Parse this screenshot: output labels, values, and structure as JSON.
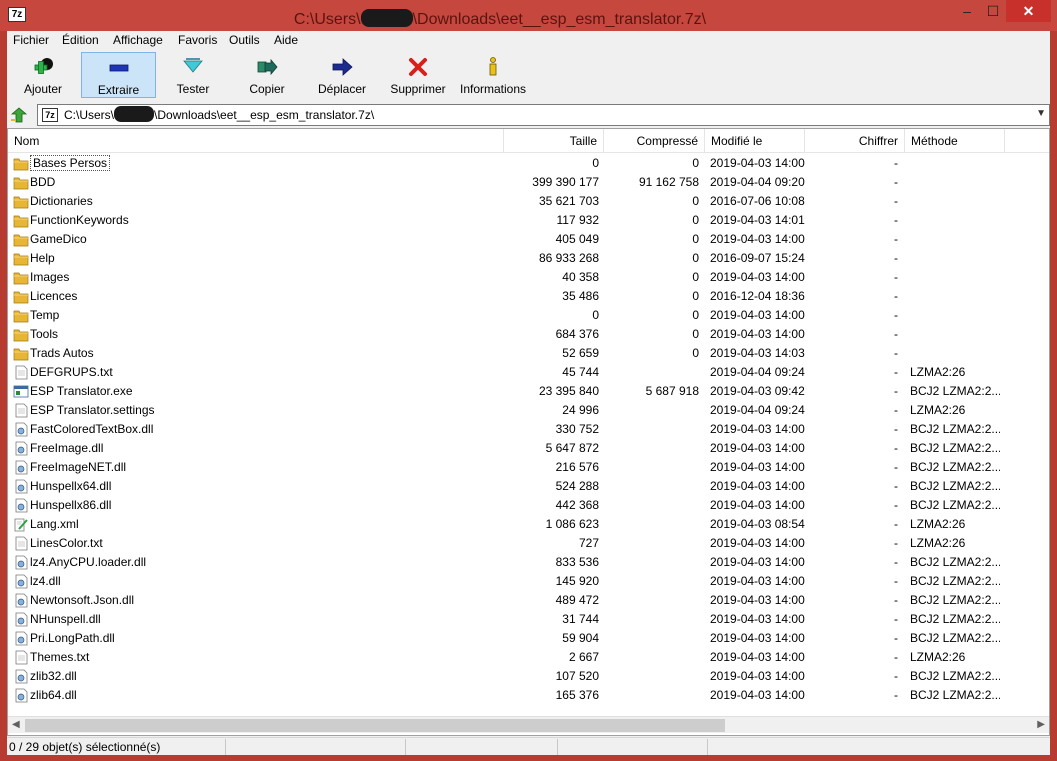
{
  "window": {
    "title_prefix": "C:\\Users\\",
    "title_suffix": "\\Downloads\\eet__esp_esm_translator.7z\\",
    "logo": "7z",
    "minimize": "–",
    "maximize": "☐",
    "close": "✕"
  },
  "menu": [
    "Fichier",
    "Édition",
    "Affichage",
    "Favoris",
    "Outils",
    "Aide"
  ],
  "toolbar": [
    {
      "label": "Ajouter",
      "icon": "add-plus-icon"
    },
    {
      "label": "Extraire",
      "icon": "extract-minus-icon",
      "active": true
    },
    {
      "label": "Tester",
      "icon": "test-check-icon"
    },
    {
      "label": "Copier",
      "icon": "copy-arrow-icon"
    },
    {
      "label": "Déplacer",
      "icon": "move-arrow-icon"
    },
    {
      "label": "Supprimer",
      "icon": "delete-x-icon"
    },
    {
      "label": "Informations",
      "icon": "info-icon"
    }
  ],
  "address": {
    "logo": "7z",
    "prefix": "C:\\Users\\",
    "suffix": "\\Downloads\\eet__esp_esm_translator.7z\\"
  },
  "columns": {
    "name": "Nom",
    "size": "Taille",
    "compressed": "Compressé",
    "modified": "Modifié le",
    "encrypted": "Chiffrer",
    "method": "Méthode"
  },
  "files": [
    {
      "name": "Bases Persos",
      "type": "folder",
      "size": "0",
      "compressed": "0",
      "modified": "2019-04-03 14:00",
      "encrypted": "-",
      "method": ""
    },
    {
      "name": "BDD",
      "type": "folder",
      "size": "399 390 177",
      "compressed": "91 162 758",
      "modified": "2019-04-04 09:20",
      "encrypted": "-",
      "method": ""
    },
    {
      "name": "Dictionaries",
      "type": "folder",
      "size": "35 621 703",
      "compressed": "0",
      "modified": "2016-07-06 10:08",
      "encrypted": "-",
      "method": ""
    },
    {
      "name": "FunctionKeywords",
      "type": "folder",
      "size": "117 932",
      "compressed": "0",
      "modified": "2019-04-03 14:01",
      "encrypted": "-",
      "method": ""
    },
    {
      "name": "GameDico",
      "type": "folder",
      "size": "405 049",
      "compressed": "0",
      "modified": "2019-04-03 14:00",
      "encrypted": "-",
      "method": ""
    },
    {
      "name": "Help",
      "type": "folder",
      "size": "86 933 268",
      "compressed": "0",
      "modified": "2016-09-07 15:24",
      "encrypted": "-",
      "method": ""
    },
    {
      "name": "Images",
      "type": "folder",
      "size": "40 358",
      "compressed": "0",
      "modified": "2019-04-03 14:00",
      "encrypted": "-",
      "method": ""
    },
    {
      "name": "Licences",
      "type": "folder",
      "size": "35 486",
      "compressed": "0",
      "modified": "2016-12-04 18:36",
      "encrypted": "-",
      "method": ""
    },
    {
      "name": "Temp",
      "type": "folder",
      "size": "0",
      "compressed": "0",
      "modified": "2019-04-03 14:00",
      "encrypted": "-",
      "method": ""
    },
    {
      "name": "Tools",
      "type": "folder",
      "size": "684 376",
      "compressed": "0",
      "modified": "2019-04-03 14:00",
      "encrypted": "-",
      "method": ""
    },
    {
      "name": "Trads Autos",
      "type": "folder",
      "size": "52 659",
      "compressed": "0",
      "modified": "2019-04-03 14:03",
      "encrypted": "-",
      "method": ""
    },
    {
      "name": "DEFGRUPS.txt",
      "type": "text",
      "size": "45 744",
      "compressed": "",
      "modified": "2019-04-04 09:24",
      "encrypted": "-",
      "method": "LZMA2:26"
    },
    {
      "name": "ESP Translator.exe",
      "type": "exe",
      "size": "23 395 840",
      "compressed": "5 687 918",
      "modified": "2019-04-03 09:42",
      "encrypted": "-",
      "method": "BCJ2 LZMA2:2..."
    },
    {
      "name": "ESP Translator.settings",
      "type": "text",
      "size": "24 996",
      "compressed": "",
      "modified": "2019-04-04 09:24",
      "encrypted": "-",
      "method": "LZMA2:26"
    },
    {
      "name": "FastColoredTextBox.dll",
      "type": "dll",
      "size": "330 752",
      "compressed": "",
      "modified": "2019-04-03 14:00",
      "encrypted": "-",
      "method": "BCJ2 LZMA2:2..."
    },
    {
      "name": "FreeImage.dll",
      "type": "dll",
      "size": "5 647 872",
      "compressed": "",
      "modified": "2019-04-03 14:00",
      "encrypted": "-",
      "method": "BCJ2 LZMA2:2..."
    },
    {
      "name": "FreeImageNET.dll",
      "type": "dll",
      "size": "216 576",
      "compressed": "",
      "modified": "2019-04-03 14:00",
      "encrypted": "-",
      "method": "BCJ2 LZMA2:2..."
    },
    {
      "name": "Hunspellx64.dll",
      "type": "dll",
      "size": "524 288",
      "compressed": "",
      "modified": "2019-04-03 14:00",
      "encrypted": "-",
      "method": "BCJ2 LZMA2:2..."
    },
    {
      "name": "Hunspellx86.dll",
      "type": "dll",
      "size": "442 368",
      "compressed": "",
      "modified": "2019-04-03 14:00",
      "encrypted": "-",
      "method": "BCJ2 LZMA2:2..."
    },
    {
      "name": "Lang.xml",
      "type": "xml",
      "size": "1 086 623",
      "compressed": "",
      "modified": "2019-04-03 08:54",
      "encrypted": "-",
      "method": "LZMA2:26"
    },
    {
      "name": "LinesColor.txt",
      "type": "text",
      "size": "727",
      "compressed": "",
      "modified": "2019-04-03 14:00",
      "encrypted": "-",
      "method": "LZMA2:26"
    },
    {
      "name": "lz4.AnyCPU.loader.dll",
      "type": "dll",
      "size": "833 536",
      "compressed": "",
      "modified": "2019-04-03 14:00",
      "encrypted": "-",
      "method": "BCJ2 LZMA2:2..."
    },
    {
      "name": "lz4.dll",
      "type": "dll",
      "size": "145 920",
      "compressed": "",
      "modified": "2019-04-03 14:00",
      "encrypted": "-",
      "method": "BCJ2 LZMA2:2..."
    },
    {
      "name": "Newtonsoft.Json.dll",
      "type": "dll",
      "size": "489 472",
      "compressed": "",
      "modified": "2019-04-03 14:00",
      "encrypted": "-",
      "method": "BCJ2 LZMA2:2..."
    },
    {
      "name": "NHunspell.dll",
      "type": "dll",
      "size": "31 744",
      "compressed": "",
      "modified": "2019-04-03 14:00",
      "encrypted": "-",
      "method": "BCJ2 LZMA2:2..."
    },
    {
      "name": "Pri.LongPath.dll",
      "type": "dll",
      "size": "59 904",
      "compressed": "",
      "modified": "2019-04-03 14:00",
      "encrypted": "-",
      "method": "BCJ2 LZMA2:2..."
    },
    {
      "name": "Themes.txt",
      "type": "text",
      "size": "2 667",
      "compressed": "",
      "modified": "2019-04-03 14:00",
      "encrypted": "-",
      "method": "LZMA2:26"
    },
    {
      "name": "zlib32.dll",
      "type": "dll",
      "size": "107 520",
      "compressed": "",
      "modified": "2019-04-03 14:00",
      "encrypted": "-",
      "method": "BCJ2 LZMA2:2..."
    },
    {
      "name": "zlib64.dll",
      "type": "dll",
      "size": "165 376",
      "compressed": "",
      "modified": "2019-04-03 14:00",
      "encrypted": "-",
      "method": "BCJ2 LZMA2:2..."
    }
  ],
  "status": {
    "text": "0 / 29 objet(s) sélectionné(s)"
  },
  "colors": {
    "titlebar": "#c5473e",
    "selected_tool": "#cce4f7",
    "folder": "#e8b636"
  }
}
